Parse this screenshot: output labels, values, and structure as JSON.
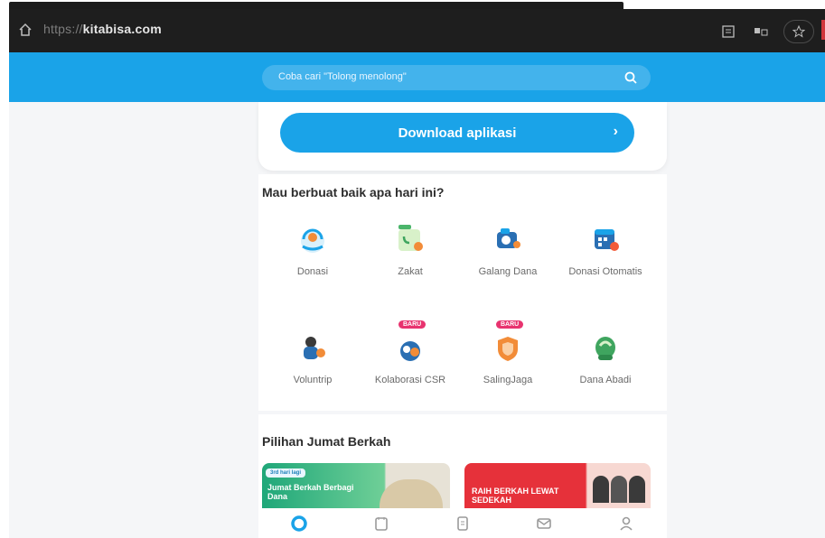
{
  "browser": {
    "url_scheme": "https://",
    "url_host": "kitabisa.com"
  },
  "header": {
    "search_placeholder": "Coba cari \"Tolong menolong\""
  },
  "download": {
    "label": "Download aplikasi"
  },
  "main": {
    "title": "Mau berbuat baik apa hari ini?",
    "items": [
      {
        "label": "Donasi",
        "icon": "donasi-icon"
      },
      {
        "label": "Zakat",
        "icon": "zakat-icon"
      },
      {
        "label": "Galang Dana",
        "icon": "galang-dana-icon"
      },
      {
        "label": "Donasi Otomatis",
        "icon": "donasi-otomatis-icon"
      },
      {
        "label": "Voluntrip",
        "icon": "voluntrip-icon"
      },
      {
        "label": "Kolaborasi CSR",
        "icon": "kolaborasi-csr-icon",
        "badge": "BARU"
      },
      {
        "label": "SalingJaga",
        "icon": "saling-jaga-icon",
        "badge": "BARU"
      },
      {
        "label": "Dana Abadi",
        "icon": "dana-abadi-icon"
      }
    ]
  },
  "jumat": {
    "title": "Pilihan Jumat Berkah",
    "banner1_tag": "3rd hari lagi",
    "banner1_text": "Jumat Berkah Berbagi Dana",
    "banner2_text": "RAIH BERKAH LEWAT SEDEKAH"
  },
  "colors": {
    "brand": "#1aa3e8",
    "browser_bar": "#1e1e1e"
  }
}
